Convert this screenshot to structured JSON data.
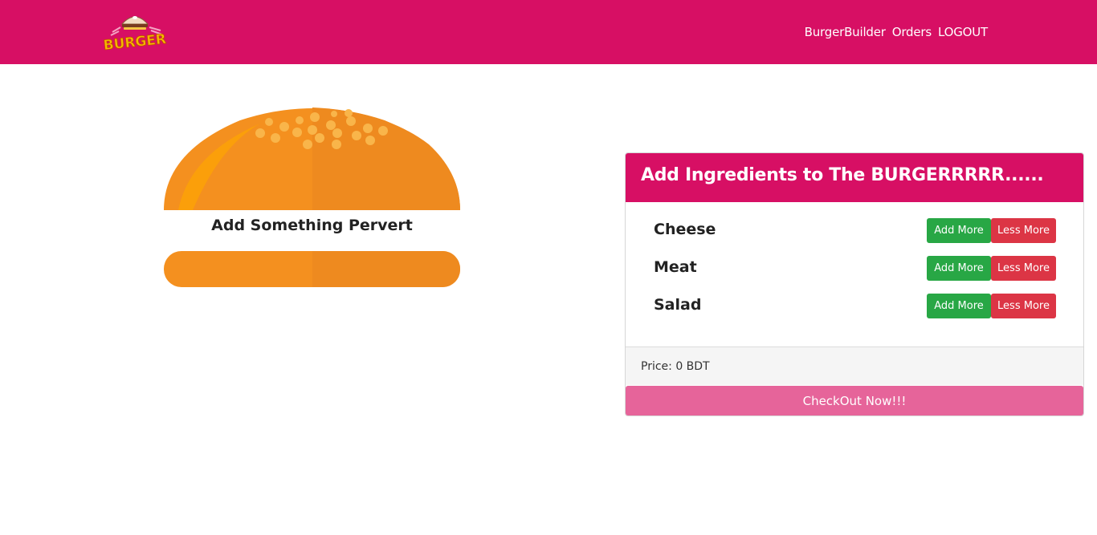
{
  "navbar": {
    "logo_text": "BURGER",
    "links": [
      "BurgerBuilder",
      "Orders",
      "LOGOUT"
    ]
  },
  "burger": {
    "empty_message": "Add Something Pervert"
  },
  "controls": {
    "title": "Add Ingredients to The BURGERRRRR......",
    "ingredients": [
      {
        "label": "Cheese",
        "add_label": "Add More",
        "remove_label": "Less More"
      },
      {
        "label": "Meat",
        "add_label": "Add More",
        "remove_label": "Less More"
      },
      {
        "label": "Salad",
        "add_label": "Add More",
        "remove_label": "Less More"
      }
    ],
    "price_text": "Price: 0 BDT",
    "checkout_label": "CheckOut Now!!!"
  },
  "colors": {
    "brand": "#d70f64",
    "bread": "#f4901f",
    "add": "#28a745",
    "remove": "#dc3545",
    "checkout": "#e6649a"
  }
}
